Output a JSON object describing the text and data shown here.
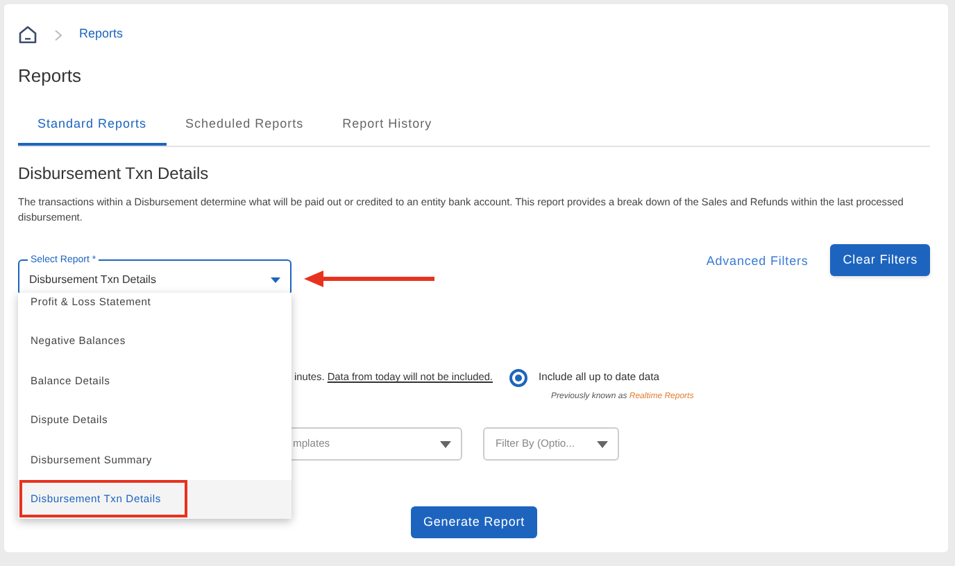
{
  "breadcrumb": {
    "items": [
      "Reports"
    ]
  },
  "page_title": "Reports",
  "tabs": [
    {
      "label": "Standard Reports",
      "selected": true
    },
    {
      "label": "Scheduled Reports",
      "selected": false
    },
    {
      "label": "Report History",
      "selected": false
    }
  ],
  "section": {
    "title": "Disbursement Txn Details",
    "description": "The transactions within a Disbursement determine what will be paid out or credited to an entity bank account. This report provides a break down of the Sales and Refunds within the last processed disbursement."
  },
  "select_report": {
    "label": "Select Report *",
    "value": "Disbursement Txn Details",
    "options": [
      {
        "label": "Profit & Loss Statement",
        "selected": false
      },
      {
        "label": "Negative Balances",
        "selected": false
      },
      {
        "label": "Balance Details",
        "selected": false
      },
      {
        "label": "Dispute Details",
        "selected": false
      },
      {
        "label": "Disbursement Summary",
        "selected": false
      },
      {
        "label": "Disbursement Txn Details",
        "selected": true
      }
    ]
  },
  "advanced_filters": "Advanced Filters",
  "clear_filters": "Clear Filters",
  "data_note": {
    "text": "inutes.",
    "link": "Data from today will not be included."
  },
  "realtime_option": {
    "label": "Include all up to date data",
    "selected": true,
    "note": "Previously known as",
    "note_link": "Realtime Reports"
  },
  "template_select": {
    "value": "mplates"
  },
  "filter_select": {
    "placeholder": "Filter By (Optio..."
  },
  "generate_button": "Generate Report"
}
